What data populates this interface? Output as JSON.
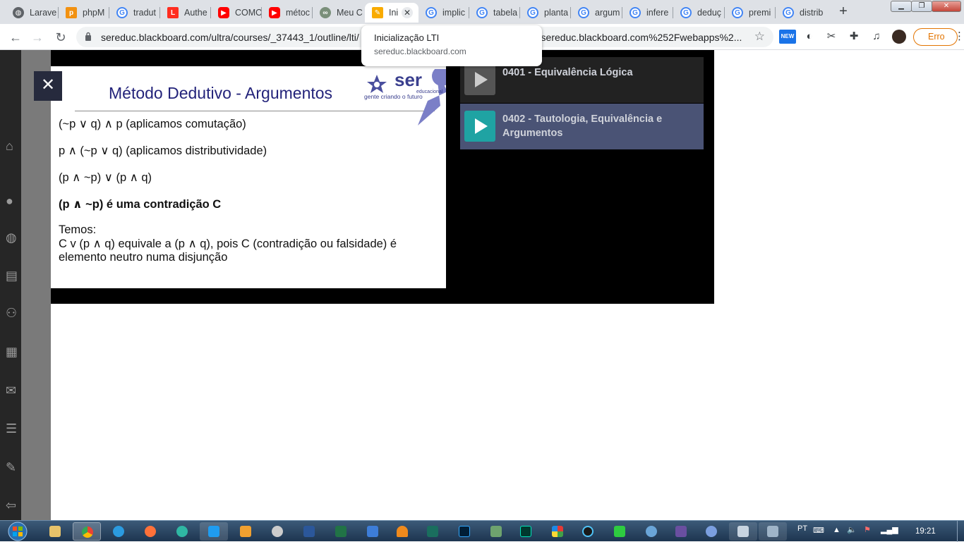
{
  "browser": {
    "tabs": [
      {
        "label": "Larave",
        "icon": "globe-icon",
        "color": "#5f6368"
      },
      {
        "label": "phpM",
        "icon": "phpmyadmin-icon",
        "color": "#f29111"
      },
      {
        "label": "tradut",
        "icon": "google-icon",
        "color": "#4285f4"
      },
      {
        "label": "Authe",
        "icon": "laravel-icon",
        "color": "#ff2d20"
      },
      {
        "label": "COMO",
        "icon": "youtube-icon",
        "color": "#ff0000"
      },
      {
        "label": "métoc",
        "icon": "youtube-icon",
        "color": "#ff0000"
      },
      {
        "label": "Meu C",
        "icon": "link-icon",
        "color": "#5f6368"
      },
      {
        "label": "Ini",
        "icon": "pencil-icon",
        "color": "#f9ab00",
        "active": true
      },
      {
        "label": "implic",
        "icon": "google-icon",
        "color": "#4285f4"
      },
      {
        "label": "tabela",
        "icon": "google-icon",
        "color": "#4285f4"
      },
      {
        "label": "planta",
        "icon": "google-icon",
        "color": "#4285f4"
      },
      {
        "label": "argum",
        "icon": "google-icon",
        "color": "#4285f4"
      },
      {
        "label": "infere",
        "icon": "google-icon",
        "color": "#4285f4"
      },
      {
        "label": "deduç",
        "icon": "google-icon",
        "color": "#4285f4"
      },
      {
        "label": "premi",
        "icon": "google-icon",
        "color": "#4285f4"
      },
      {
        "label": "distrib",
        "icon": "google-icon",
        "color": "#4285f4"
      }
    ],
    "url_start": "sereduc.blackboard.com/ultra/courses/_37443_1/outline/lti/",
    "url_end": "Fsereduc.blackboard.com%252Fwebapps%2...",
    "error_label": "Erro",
    "tooltip": {
      "title": "Inicialização LTI",
      "subtitle": "sereduc.blackboard.com"
    }
  },
  "slide": {
    "title": "Método Dedutivo - Argumentos",
    "logo_text": "ser",
    "logo_sub": "educacional",
    "logo_tagline": "gente criando o futuro",
    "lines": [
      {
        "text": "(~p ∨ q) ∧ p (aplicamos comutação)",
        "bold": false
      },
      {
        "text": "p ∧ (~p ∨ q) (aplicamos distributividade)",
        "bold": false
      },
      {
        "text": "(p ∧ ~p) ∨ (p ∧ q)",
        "bold": false
      },
      {
        "text": "(p ∧ ~p) é uma contradição C",
        "bold": true
      },
      {
        "text": "Temos:",
        "bold": false
      },
      {
        "text": "C v (p ∧ q) equivale a (p ∧ q), pois C (contradição ou falsidade) é",
        "bold": false
      },
      {
        "text": "elemento neutro numa disjunção",
        "bold": false
      }
    ]
  },
  "playlist": [
    {
      "title": "0401 - Equivalência Lógica",
      "active": false
    },
    {
      "title": "0402 - Tautologia, Equivalência e Argumentos",
      "active": true
    }
  ],
  "colors": {
    "playlist_active_bg": "#4a5375",
    "playlist_inactive_bg": "#222222",
    "thumb_active": "#1fa3a3",
    "thumb_inactive": "#555555",
    "slide_title": "#23237a"
  },
  "taskbar": {
    "apps": [
      "explorer-icon",
      "chrome-icon",
      "ie-icon",
      "firefox-icon",
      "edge-icon",
      "vscode-icon",
      "media-icon",
      "winamp-icon",
      "word-icon",
      "excel-icon",
      "puzzle-icon",
      "vlc-icon",
      "terminal-icon",
      "photoshop-icon",
      "folder-icon",
      "audition-icon",
      "paint-icon",
      "cortana-icon",
      "notepad-icon",
      "network-icon",
      "settings-icon",
      "chat-icon",
      "calculator-icon",
      "window-icon"
    ],
    "language": "PT",
    "time": "19:21"
  }
}
